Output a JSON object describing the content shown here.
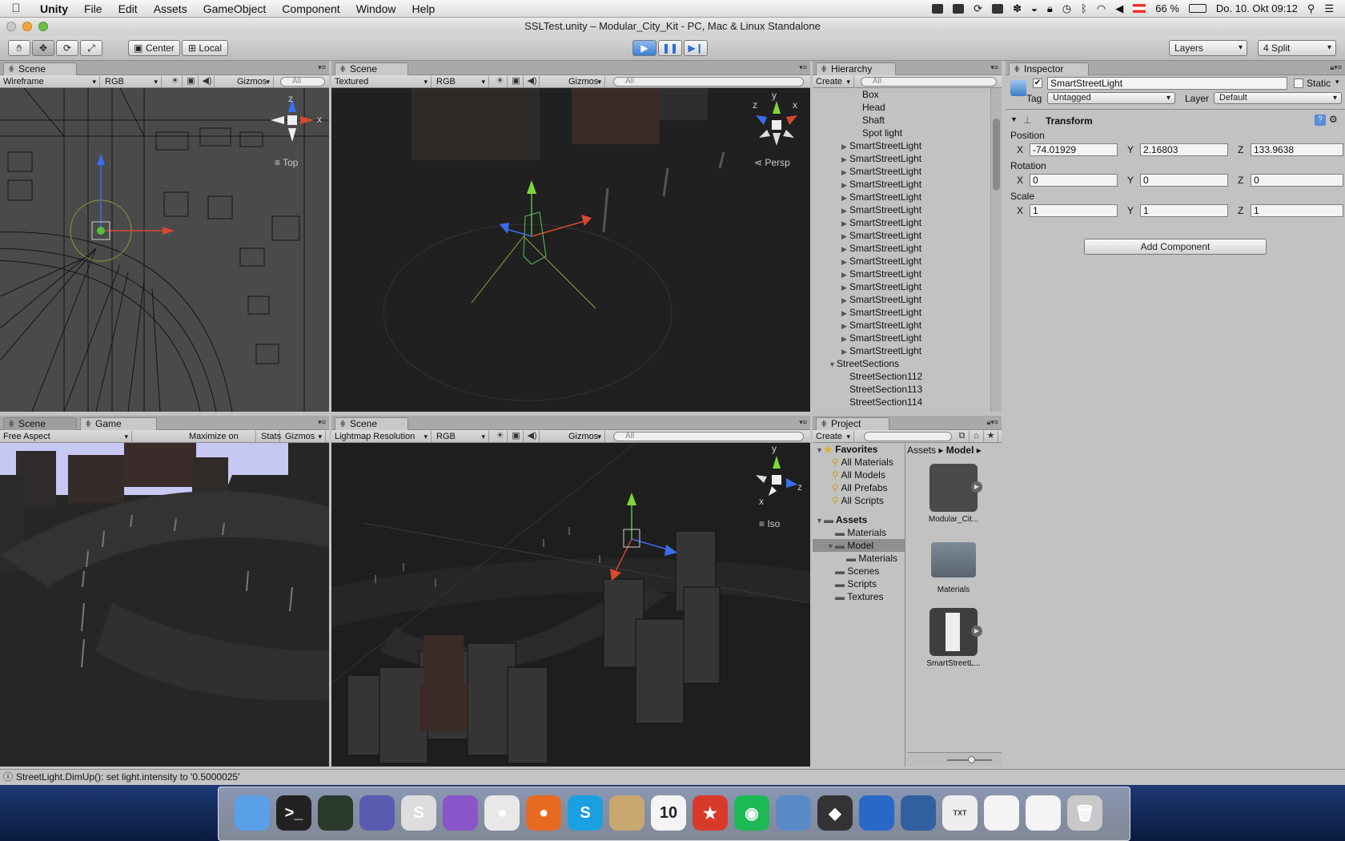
{
  "menubar": {
    "app": "Unity",
    "items": [
      "File",
      "Edit",
      "Assets",
      "GameObject",
      "Component",
      "Window",
      "Help"
    ],
    "battery": "66 %",
    "clock": "Do. 10. Okt  09:12"
  },
  "window": {
    "title": "SSLTest.unity – Modular_City_Kit - PC, Mac & Linux Standalone"
  },
  "toolbar": {
    "pivot": "Center",
    "space": "Local",
    "layers": "Layers",
    "layout": "4 Split"
  },
  "scene_tl": {
    "tab": "Scene",
    "draw_mode": "Wireframe",
    "render_mode": "RGB",
    "gizmos": "Gizmos",
    "search": "All",
    "view_label": "Top",
    "axes": {
      "z": "z",
      "x": "x"
    }
  },
  "scene_tr": {
    "tab": "Scene",
    "draw_mode": "Textured",
    "render_mode": "RGB",
    "gizmos": "Gizmos",
    "search": "All",
    "view_label": "Persp",
    "axes": {
      "y": "y",
      "x": "x",
      "z": "z"
    }
  },
  "game_bl": {
    "tab_scene": "Scene",
    "tab_game": "Game",
    "aspect": "Free Aspect",
    "maximize": "Maximize on Play",
    "stats": "Stats",
    "gizmos": "Gizmos"
  },
  "scene_br": {
    "tab": "Scene",
    "draw_mode": "Lightmap Resolution",
    "render_mode": "RGB",
    "gizmos": "Gizmos",
    "search": "All",
    "view_label": "Iso",
    "axes": {
      "y": "y",
      "x": "x",
      "z": "z"
    }
  },
  "hierarchy": {
    "tab": "Hierarchy",
    "create": "Create",
    "search": "All",
    "rows": [
      {
        "label": "Box",
        "indent": 3,
        "arrow": ""
      },
      {
        "label": "Head",
        "indent": 3,
        "arrow": ""
      },
      {
        "label": "Shaft",
        "indent": 3,
        "arrow": ""
      },
      {
        "label": "Spot light",
        "indent": 3,
        "arrow": ""
      },
      {
        "label": "SmartStreetLight",
        "indent": 2,
        "arrow": "▶"
      },
      {
        "label": "SmartStreetLight",
        "indent": 2,
        "arrow": "▶"
      },
      {
        "label": "SmartStreetLight",
        "indent": 2,
        "arrow": "▶"
      },
      {
        "label": "SmartStreetLight",
        "indent": 2,
        "arrow": "▶"
      },
      {
        "label": "SmartStreetLight",
        "indent": 2,
        "arrow": "▶"
      },
      {
        "label": "SmartStreetLight",
        "indent": 2,
        "arrow": "▶"
      },
      {
        "label": "SmartStreetLight",
        "indent": 2,
        "arrow": "▶"
      },
      {
        "label": "SmartStreetLight",
        "indent": 2,
        "arrow": "▶"
      },
      {
        "label": "SmartStreetLight",
        "indent": 2,
        "arrow": "▶"
      },
      {
        "label": "SmartStreetLight",
        "indent": 2,
        "arrow": "▶"
      },
      {
        "label": "SmartStreetLight",
        "indent": 2,
        "arrow": "▶"
      },
      {
        "label": "SmartStreetLight",
        "indent": 2,
        "arrow": "▶"
      },
      {
        "label": "SmartStreetLight",
        "indent": 2,
        "arrow": "▶"
      },
      {
        "label": "SmartStreetLight",
        "indent": 2,
        "arrow": "▶"
      },
      {
        "label": "SmartStreetLight",
        "indent": 2,
        "arrow": "▶"
      },
      {
        "label": "SmartStreetLight",
        "indent": 2,
        "arrow": "▶"
      },
      {
        "label": "SmartStreetLight",
        "indent": 2,
        "arrow": "▶"
      },
      {
        "label": "StreetSections",
        "indent": 1,
        "arrow": "▼"
      },
      {
        "label": "StreetSection112",
        "indent": 2,
        "arrow": ""
      },
      {
        "label": "StreetSection113",
        "indent": 2,
        "arrow": ""
      },
      {
        "label": "StreetSection114",
        "indent": 2,
        "arrow": ""
      }
    ]
  },
  "project": {
    "tab": "Project",
    "create": "Create",
    "favorites_title": "Favorites",
    "favorites": [
      "All Materials",
      "All Models",
      "All Prefabs",
      "All Scripts"
    ],
    "assets_title": "Assets",
    "folders": [
      {
        "label": "Materials",
        "indent": 1,
        "arrow": ""
      },
      {
        "label": "Model",
        "indent": 1,
        "arrow": "▼",
        "selected": true
      },
      {
        "label": "Materials",
        "indent": 2,
        "arrow": ""
      },
      {
        "label": "Scenes",
        "indent": 1,
        "arrow": ""
      },
      {
        "label": "Scripts",
        "indent": 1,
        "arrow": ""
      },
      {
        "label": "Textures",
        "indent": 1,
        "arrow": ""
      }
    ],
    "breadcrumb_root": "Assets",
    "breadcrumb_current": "Model",
    "items": [
      "Modular_Cit...",
      "Materials",
      "SmartStreetL..."
    ]
  },
  "inspector": {
    "tab": "Inspector",
    "object_name": "SmartStreetLight",
    "static_label": "Static",
    "tag_label": "Tag",
    "tag_value": "Untagged",
    "layer_label": "Layer",
    "layer_value": "Default",
    "component": "Transform",
    "position_label": "Position",
    "rotation_label": "Rotation",
    "scale_label": "Scale",
    "axis_x": "X",
    "axis_y": "Y",
    "axis_z": "Z",
    "position": {
      "x": "-74.01929",
      "y": "2.16803",
      "z": "133.9638"
    },
    "rotation": {
      "x": "0",
      "y": "0",
      "z": "0"
    },
    "scale": {
      "x": "1",
      "y": "1",
      "z": "1"
    },
    "add_component": "Add Component"
  },
  "status": {
    "message": "StreetLight.DimUp(): set light.intensity to '0.5000025'"
  },
  "dock": {
    "icons": [
      "finder-icon",
      "terminal-icon",
      "activity-monitor-icon",
      "eclipse-icon",
      "sublime-text-icon",
      "ocarina-icon",
      "chrome-icon",
      "firefox-icon",
      "skype-icon",
      "preview-icon",
      "calendar-icon",
      "wunderlist-icon",
      "spotify-icon",
      "iphoto-icon",
      "unity-icon",
      "remote-desktop-icon",
      "virtualbox-icon",
      "document-icon",
      "document-icon-2",
      "document-icon-3",
      "trash-icon"
    ],
    "calendar_day": "10",
    "doc_label": "TXT"
  }
}
